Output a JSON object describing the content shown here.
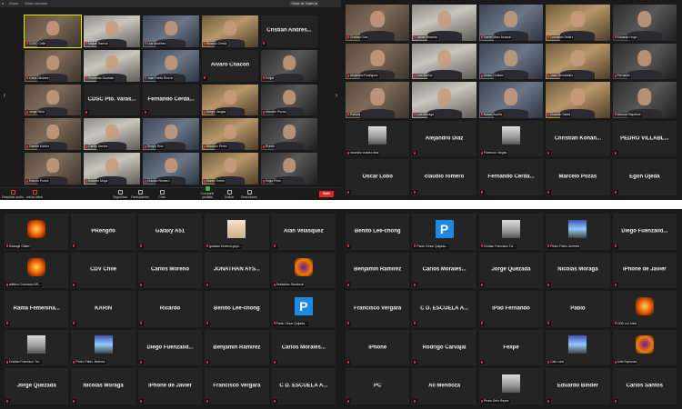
{
  "window": {
    "title": "Zoom",
    "meeting_info": "Zoom reunión",
    "view_label": "Vista de Galería"
  },
  "toolbar": {
    "buttons": [
      {
        "label": "Reactivar audio",
        "icon": "microphone-off-icon"
      },
      {
        "label": "Iniciar video",
        "icon": "video-off-icon"
      },
      {
        "label": "Seguridad",
        "icon": "shield-icon"
      },
      {
        "label": "Participantes",
        "icon": "participants-icon",
        "count": "143"
      },
      {
        "label": "Chat",
        "icon": "chat-icon"
      },
      {
        "label": "Compartir pantalla",
        "icon": "share-screen-icon"
      },
      {
        "label": "Grabar",
        "icon": "record-icon"
      },
      {
        "label": "Reacciones",
        "icon": "reactions-icon"
      }
    ],
    "end_label": "Salir",
    "colors": {
      "accent": "#4caf50",
      "end": "#e02828",
      "active_speaker": "#e8e200"
    }
  },
  "grid_a": [
    {
      "name": "CDSC Chile",
      "kind": "video"
    },
    {
      "name": "Miguel Ramos",
      "kind": "video"
    },
    {
      "name": "Luis Martinez",
      "kind": "video"
    },
    {
      "name": "Ricardo Cerda",
      "kind": "video"
    },
    {
      "name": "Cristian Andres...",
      "kind": "text"
    },
    {
      "name": "Carla Olivares",
      "kind": "video"
    },
    {
      "name": "Fernando Guzman",
      "kind": "video"
    },
    {
      "name": "Juan Pablo Rivera",
      "kind": "video"
    },
    {
      "name": "Alvaro Chacón",
      "kind": "text"
    },
    {
      "name": "Felipe",
      "kind": "video"
    },
    {
      "name": "Jorge Silva",
      "kind": "video"
    },
    {
      "name": "CDSC Pto. Varas...",
      "kind": "text"
    },
    {
      "name": "Fernando Cerda...",
      "kind": "text"
    },
    {
      "name": "Sergio Vargas",
      "kind": "video"
    },
    {
      "name": "Marcelo Pozas",
      "kind": "video"
    },
    {
      "name": "Gabriel Muñoz",
      "kind": "video"
    },
    {
      "name": "Carlos Santos",
      "kind": "video"
    },
    {
      "name": "Sergio Ruiz",
      "kind": "video"
    },
    {
      "name": "Mauricio Pérez",
      "kind": "video"
    },
    {
      "name": "Rubén",
      "kind": "video"
    },
    {
      "name": "Ramón Ponce",
      "kind": "video"
    },
    {
      "name": "Roberto Moya",
      "kind": "video"
    },
    {
      "name": "Claudio Romero",
      "kind": "video"
    },
    {
      "name": "Daniel Torres",
      "kind": "video"
    },
    {
      "name": "Hugo Pinto",
      "kind": "video"
    }
  ],
  "grid_b": [
    {
      "name": "Cristian Díaz",
      "kind": "video"
    },
    {
      "name": "Jaime Miranda",
      "kind": "video"
    },
    {
      "name": "Daniel Marc Azzarat",
      "kind": "video"
    },
    {
      "name": "Leonardo Delaíz",
      "kind": "video"
    },
    {
      "name": "Eduardo Hugo",
      "kind": "video"
    },
    {
      "name": "Alejandra Rodriguez",
      "kind": "video"
    },
    {
      "name": "Luis Muñoz",
      "kind": "video"
    },
    {
      "name": "Alvaro Giuliani",
      "kind": "video"
    },
    {
      "name": "Juan Hernandez",
      "kind": "video"
    },
    {
      "name": "Fernando",
      "kind": "video"
    },
    {
      "name": "Patricia",
      "kind": "video"
    },
    {
      "name": "Luis Moraga",
      "kind": "video"
    },
    {
      "name": "Rafael Acuña",
      "kind": "video"
    },
    {
      "name": "Eusebio Santa",
      "kind": "video"
    },
    {
      "name": "Mónica Riquelme",
      "kind": "video"
    },
    {
      "name": "mauricio cuadra díaz",
      "kind": "photo"
    },
    {
      "name": "Alejandro Díaz",
      "kind": "text"
    },
    {
      "name": "Florencio Vargas",
      "kind": "photo"
    },
    {
      "name": "Christian Kohan...",
      "kind": "text"
    },
    {
      "name": "PEDRO VILLABL...",
      "kind": "text"
    },
    {
      "name": "Oscar Lobo",
      "kind": "text"
    },
    {
      "name": "claudio romero",
      "kind": "text"
    },
    {
      "name": "Fernando Cerda...",
      "kind": "text"
    },
    {
      "name": "Marcelo Pozas",
      "kind": "text"
    },
    {
      "name": "Egon Ojeda",
      "kind": "text"
    }
  ],
  "grid_c": [
    {
      "name": "Solange Gilard",
      "kind": "logo"
    },
    {
      "name": "PRengifo",
      "kind": "text"
    },
    {
      "name": "Galaxy A51",
      "kind": "text"
    },
    {
      "name": "gustavo becerra goyc...",
      "kind": "shape"
    },
    {
      "name": "Alan Velasquez",
      "kind": "text"
    },
    {
      "name": "atlético Coronado AR...",
      "kind": "logo"
    },
    {
      "name": "CDV Chile",
      "kind": "text"
    },
    {
      "name": "Carlos Moreno",
      "kind": "text"
    },
    {
      "name": "JONATHAN AYS...",
      "kind": "text"
    },
    {
      "name": "Sebastian Sandoval",
      "kind": "logo2"
    },
    {
      "name": "Rama Femenina...",
      "kind": "text"
    },
    {
      "name": "KARIN",
      "kind": "text"
    },
    {
      "name": "Ricardo",
      "kind": "text"
    },
    {
      "name": "Benito Lee-chong",
      "kind": "text"
    },
    {
      "name": "Paolo César Quijada...",
      "kind": "p"
    },
    {
      "name": "Cristian Francisco Tor...",
      "kind": "photo"
    },
    {
      "name": "Pedro Pablo Jiménez",
      "kind": "photo2"
    },
    {
      "name": "Diego Fuenzalid...",
      "kind": "text"
    },
    {
      "name": "Benjamín Ramírez",
      "kind": "text"
    },
    {
      "name": "Carlos Morales...",
      "kind": "text"
    },
    {
      "name": "Jorge Quezada",
      "kind": "text"
    },
    {
      "name": "Nicolás Moraga",
      "kind": "text"
    },
    {
      "name": "iPhone de Javier",
      "kind": "text"
    },
    {
      "name": "Francisco Vergara",
      "kind": "text"
    },
    {
      "name": "C D. ESCUELA A...",
      "kind": "text"
    }
  ],
  "grid_d": [
    {
      "name": "Benito Lee-chong",
      "kind": "text"
    },
    {
      "name": "Paolo César Quijada...",
      "kind": "p"
    },
    {
      "name": "Cristian Francisco Tor...",
      "kind": "photo"
    },
    {
      "name": "Pedro Pablo Jiménez",
      "kind": "photo2"
    },
    {
      "name": "Diego Fuenzalid...",
      "kind": "text"
    },
    {
      "name": "Benjamín Ramírez",
      "kind": "text"
    },
    {
      "name": "Carlos Morales...",
      "kind": "text"
    },
    {
      "name": "Jorge Quezada",
      "kind": "text"
    },
    {
      "name": "Nicolás Moraga",
      "kind": "text"
    },
    {
      "name": "iPhone de Javier",
      "kind": "text"
    },
    {
      "name": "Francisco Vergara",
      "kind": "text"
    },
    {
      "name": "C D. ESCUELA A...",
      "kind": "text"
    },
    {
      "name": "iPad Fernando",
      "kind": "text"
    },
    {
      "name": "Pablo",
      "kind": "text"
    },
    {
      "name": "CDB La Unión",
      "kind": "logo"
    },
    {
      "name": "iPhone",
      "kind": "text"
    },
    {
      "name": "Rodrigo Carvajal",
      "kind": "text"
    },
    {
      "name": "Felipe",
      "kind": "text"
    },
    {
      "name": "Caio Lara",
      "kind": "photo2"
    },
    {
      "name": "Ariel Espinoza",
      "kind": "logo2"
    },
    {
      "name": "PC",
      "kind": "text"
    },
    {
      "name": "Ali Mendoza",
      "kind": "text"
    },
    {
      "name": "Pedro Ortiz Reyes",
      "kind": "photo"
    },
    {
      "name": "Eduardo Binder",
      "kind": "text"
    },
    {
      "name": "Carlos Santos",
      "kind": "text"
    }
  ]
}
